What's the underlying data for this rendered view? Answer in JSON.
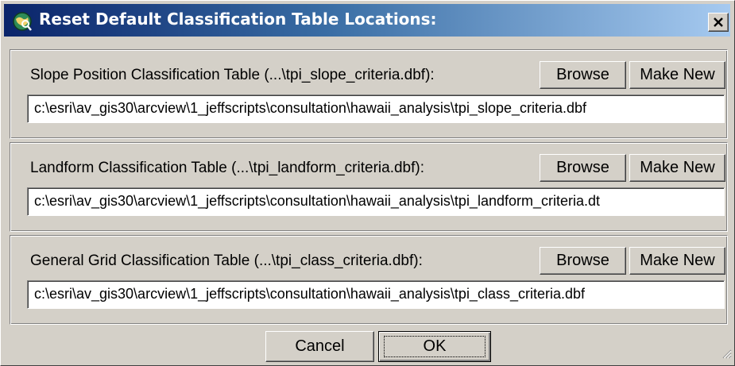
{
  "window": {
    "title": "Reset Default Classification Table Locations:",
    "icon": "arcview-globe-icon",
    "close_label": "X"
  },
  "sections": [
    {
      "label": "Slope Position Classification Table (...\\tpi_slope_criteria.dbf):",
      "browse_label": "Browse",
      "make_new_label": "Make New",
      "path": "c:\\esri\\av_gis30\\arcview\\1_jeffscripts\\consultation\\hawaii_analysis\\tpi_slope_criteria.dbf"
    },
    {
      "label": "Landform Classification Table (...\\tpi_landform_criteria.dbf):",
      "browse_label": "Browse",
      "make_new_label": "Make New",
      "path": "c:\\esri\\av_gis30\\arcview\\1_jeffscripts\\consultation\\hawaii_analysis\\tpi_landform_criteria.dt"
    },
    {
      "label": "General Grid Classification Table (...\\tpi_class_criteria.dbf):",
      "browse_label": "Browse",
      "make_new_label": "Make New",
      "path": "c:\\esri\\av_gis30\\arcview\\1_jeffscripts\\consultation\\hawaii_analysis\\tpi_class_criteria.dbf"
    }
  ],
  "footer": {
    "cancel_label": "Cancel",
    "ok_label": "OK"
  },
  "colors": {
    "face": "#d4d0c8",
    "title_start": "#0a246a",
    "title_end": "#a6caf0"
  }
}
